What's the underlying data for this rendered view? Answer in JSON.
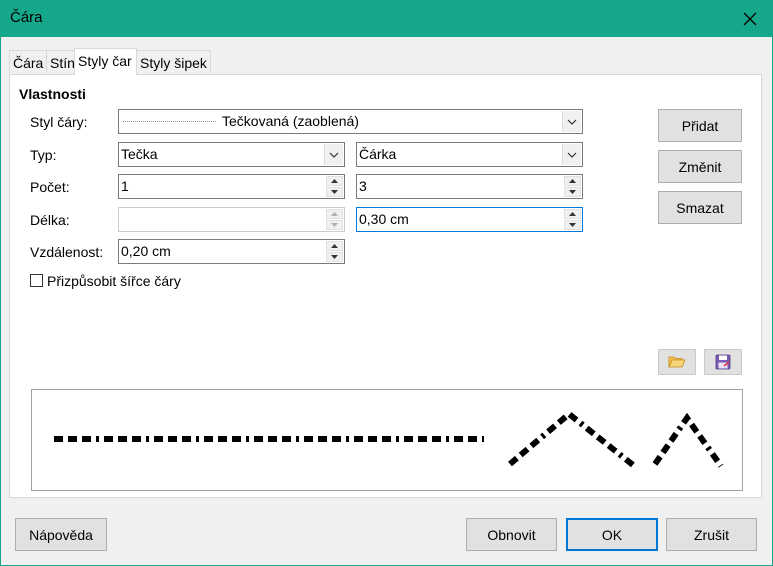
{
  "window": {
    "title": "Čára"
  },
  "tabs": [
    {
      "label": "Čára"
    },
    {
      "label": "Stín"
    },
    {
      "label": "Styly čar"
    },
    {
      "label": "Styly šipek"
    }
  ],
  "properties": {
    "heading": "Vlastnosti",
    "line_style": {
      "label": "Styl čáry:",
      "value": "Tečkovaná (zaoblená)"
    },
    "type": {
      "label": "Typ:",
      "value1": "Tečka",
      "value2": "Čárka"
    },
    "count": {
      "label": "Počet:",
      "value1": "1",
      "value2": "3"
    },
    "length": {
      "label": "Délka:",
      "value1": "",
      "value2": "0,30 cm"
    },
    "spacing": {
      "label": "Vzdálenost:",
      "value": "0,20 cm"
    },
    "fit_to_width": {
      "label": "Přizpůsobit šířce čáry",
      "checked": false
    }
  },
  "side_buttons": {
    "add": "Přidat",
    "modify": "Změnit",
    "delete": "Smazat"
  },
  "icons": {
    "open": "folder-open-icon",
    "save": "save-icon"
  },
  "footer": {
    "help": "Nápověda",
    "reset": "Obnovit",
    "ok": "OK",
    "cancel": "Zrušit"
  },
  "colors": {
    "titlebar": "#14a789",
    "focus": "#0078d7"
  }
}
